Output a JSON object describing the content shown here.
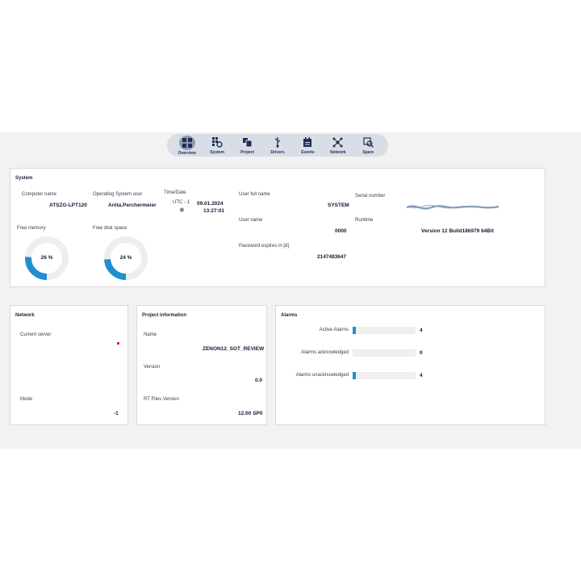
{
  "nav": [
    {
      "label": "Overview",
      "icon": "overview-icon",
      "active": true
    },
    {
      "label": "System",
      "icon": "system-icon"
    },
    {
      "label": "Project",
      "icon": "project-icon"
    },
    {
      "label": "Drivers",
      "icon": "drivers-icon"
    },
    {
      "label": "Events",
      "icon": "events-icon"
    },
    {
      "label": "Network",
      "icon": "network-icon"
    },
    {
      "label": "Spare",
      "icon": "spare-icon"
    }
  ],
  "system": {
    "title": "System",
    "computer_name_label": "Computer name",
    "computer_name": "ATSZG-LPT120",
    "os_user_label": "Operating System user",
    "os_user": "Anita.Perchermeier",
    "time_label": "Time/Date",
    "timezone": "UTC - 1",
    "date": "09.01.2024",
    "time": "13:27:01",
    "full_name_label": "User full name",
    "full_name": "SYSTEM",
    "user_name_label": "User name",
    "user_name": "0000",
    "password_label": "Password expires in [d]",
    "password_days": "2147483647",
    "serial_label": "Serial number",
    "runtime_label": "Runtime",
    "runtime": "Version 12 Build186979 64Bit",
    "free_memory_label": "Free memory",
    "free_memory": "26 %",
    "free_memory_pct": 26,
    "free_disk_label": "Free disk space",
    "free_disk": "24 %",
    "free_disk_pct": 24
  },
  "network": {
    "title": "Network",
    "current_server_label": "Current server",
    "mode_label": "Mode",
    "mode": "-1"
  },
  "project": {
    "title": "Project information",
    "name_label": "Name",
    "name": "ZENON12_SOT_REVIEW",
    "version_label": "Version",
    "version": "0.0",
    "rt_label": "RT Files Version",
    "rt_version": "12.00 SP0"
  },
  "alarms": {
    "title": "Alarms",
    "rows": [
      {
        "label": "Active Alarms",
        "count": "4",
        "fill_fraction": 0.05
      },
      {
        "label": "Alarms acknowledged",
        "count": "0",
        "fill_fraction": 0
      },
      {
        "label": "Alarms unacknowledged",
        "count": "4",
        "fill_fraction": 0.05
      }
    ]
  },
  "colors": {
    "accent": "#1f8fd0",
    "nav_text": "#1e2f55",
    "status_red": "#e8212b"
  }
}
